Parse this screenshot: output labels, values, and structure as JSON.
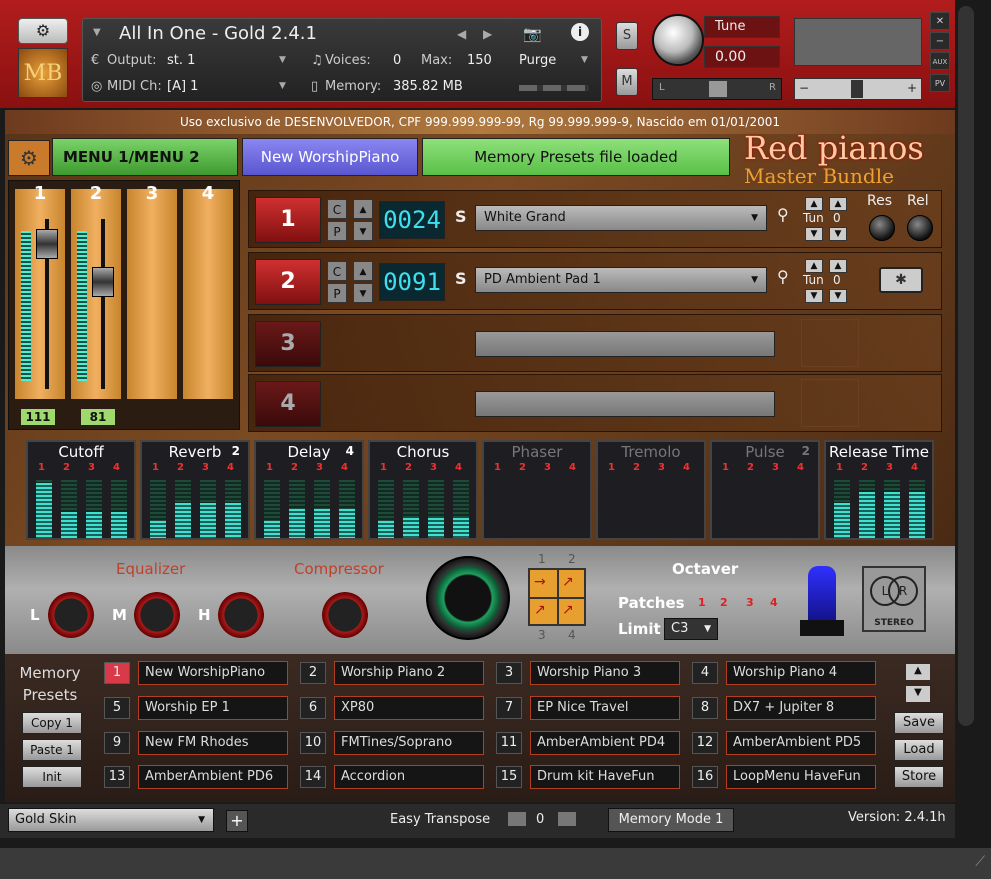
{
  "header": {
    "instrument_title": "All In One - Gold 2.4.1",
    "output_label": "Output:",
    "output_value": "st. 1",
    "midi_label": "MIDI Ch:",
    "midi_value": "[A]  1",
    "voices_label": "Voices:",
    "voices_value": "0",
    "max_label": "Max:",
    "max_value": "150",
    "memory_label": "Memory:",
    "memory_value": "385.82 MB",
    "purge_label": "Purge",
    "s_btn": "S",
    "m_btn": "M",
    "tune_label": "Tune",
    "tune_value": "0.00",
    "logo_text": "MB",
    "pan_l": "L",
    "pan_r": "R",
    "aux": "AUX",
    "pv": "PV"
  },
  "notice": "Uso exclusivo de DESENVOLVEDOR, CPF 999.999.999-99, Rg 99.999.999-9, Nascido em 01/01/2001",
  "toolbar": {
    "menu_label": "MENU 1/MENU 2",
    "preset_name": "New WorshipPiano",
    "status": "Memory Presets file loaded",
    "brand_line1": "Red pianos",
    "brand_line2": "Master Bundle"
  },
  "faders": {
    "labels": [
      "1",
      "2",
      "3",
      "4"
    ],
    "values": [
      "111",
      "81"
    ]
  },
  "slots": [
    {
      "num": "1",
      "c": "C",
      "p": "P",
      "lcd": "0024",
      "s": "S",
      "patch": "White Grand",
      "tun": "Tun",
      "tun_val": "0",
      "res": "Res",
      "rel": "Rel"
    },
    {
      "num": "2",
      "c": "C",
      "p": "P",
      "lcd": "0091",
      "s": "S",
      "patch": "PD Ambient Pad 1",
      "tun": "Tun",
      "tun_val": "0"
    },
    {
      "num": "3"
    },
    {
      "num": "4"
    }
  ],
  "effects": [
    {
      "title": "Cutoff",
      "levels": [
        0.95,
        0.45,
        0.45,
        0.45
      ],
      "active": true
    },
    {
      "title": "Reverb",
      "badge": "2",
      "levels": [
        0.3,
        0.6,
        0.6,
        0.6
      ],
      "active": true
    },
    {
      "title": "Delay",
      "badge": "4",
      "levels": [
        0.3,
        0.5,
        0.5,
        0.5
      ],
      "active": true
    },
    {
      "title": "Chorus",
      "levels": [
        0.3,
        0.35,
        0.35,
        0.35
      ],
      "active": true
    },
    {
      "title": "Phaser",
      "levels": [
        0,
        0,
        0,
        0
      ],
      "active": false
    },
    {
      "title": "Tremolo",
      "levels": [
        0,
        0,
        0,
        0
      ],
      "active": false
    },
    {
      "title": "Pulse",
      "badge": "2",
      "levels": [
        0,
        0,
        0,
        0
      ],
      "active": false
    },
    {
      "title": "Release Time",
      "levels": [
        0.6,
        0.8,
        0.8,
        0.8
      ],
      "active": true
    }
  ],
  "fx_channels": [
    "1",
    "2",
    "3",
    "4"
  ],
  "lower": {
    "equalizer": "Equalizer",
    "compressor": "Compressor",
    "eq_l": "L",
    "eq_m": "M",
    "eq_h": "H",
    "xy_top1": "1",
    "xy_top2": "2",
    "xy_bot1": "3",
    "xy_bot2": "4",
    "octaver": "Octaver",
    "patches": "Patches",
    "patch_nums": [
      "1",
      "2",
      "3",
      "4"
    ],
    "limit": "Limit",
    "limit_value": "C3",
    "stereo_l": "L",
    "stereo_r": "R",
    "stereo": "STEREO"
  },
  "memory": {
    "title_line1": "Memory",
    "title_line2": "Presets",
    "copy": "Copy 1",
    "paste": "Paste 1",
    "init": "Init",
    "save": "Save",
    "load": "Load",
    "store": "Store",
    "presets": [
      {
        "num": "1",
        "name": "New WorshipPiano"
      },
      {
        "num": "2",
        "name": "Worship Piano 2"
      },
      {
        "num": "3",
        "name": "Worship Piano 3"
      },
      {
        "num": "4",
        "name": "Worship Piano 4"
      },
      {
        "num": "5",
        "name": "Worship EP 1"
      },
      {
        "num": "6",
        "name": "XP80"
      },
      {
        "num": "7",
        "name": "EP Nice Travel"
      },
      {
        "num": "8",
        "name": "DX7 + Jupiter 8"
      },
      {
        "num": "9",
        "name": "New FM Rhodes"
      },
      {
        "num": "10",
        "name": "FMTines/Soprano"
      },
      {
        "num": "11",
        "name": "AmberAmbient PD4"
      },
      {
        "num": "12",
        "name": "AmberAmbient PD5"
      },
      {
        "num": "13",
        "name": "AmberAmbient PD6"
      },
      {
        "num": "14",
        "name": "Accordion"
      },
      {
        "num": "15",
        "name": "Drum kit HaveFun"
      },
      {
        "num": "16",
        "name": "LoopMenu HaveFun"
      }
    ]
  },
  "footer": {
    "skin": "Gold Skin",
    "plus": "+",
    "transpose_label": "Easy Transpose",
    "transpose_value": "0",
    "memory_mode": "Memory Mode 1",
    "version": "Version: 2.4.1h"
  }
}
